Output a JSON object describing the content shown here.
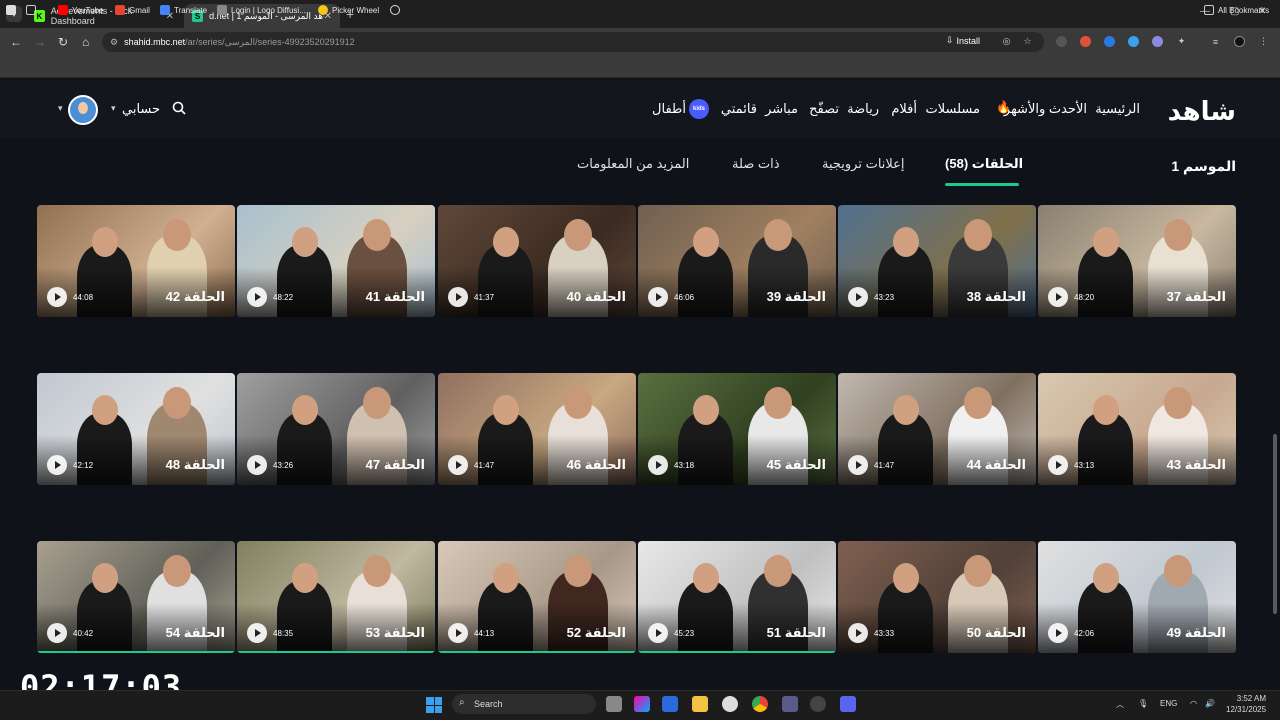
{
  "browser": {
    "tabs": [
      {
        "title": "Achievements - Kick Dashboard",
        "favicon": "K"
      },
      {
        "title": "d.net | شاهد المرسى - الموسم 1",
        "favicon": "S"
      }
    ],
    "url_host": "shahid.mbc.net",
    "url_path": "/ar/series/المرسى/series-49923520291912",
    "install_label": "Install",
    "bookmarks": [
      "YouTube",
      "Gmail",
      "Translate",
      "Login | Logo Diffusi...",
      "Picker Wheel"
    ],
    "all_bookmarks": "All Bookmarks"
  },
  "site": {
    "logo": "شاهد",
    "nav": [
      "الرئيسية",
      "الأحدث والأشهر",
      "مسلسلات",
      "أفلام",
      "رياضة",
      "تصفّح",
      "مباشر",
      "قائمتي",
      "أطفال"
    ],
    "kids_badge": "kids",
    "account_label": "حسابي"
  },
  "season": {
    "label": "الموسم 1",
    "tabs": [
      "الحلقات (58)",
      "إعلانات ترويجية",
      "ذات صلة",
      "المزيد من المعلومات"
    ]
  },
  "episodes": [
    {
      "title": "الحلقة 37",
      "duration": "48:20"
    },
    {
      "title": "الحلقة 38",
      "duration": "43:23"
    },
    {
      "title": "الحلقة 39",
      "duration": "46:06"
    },
    {
      "title": "الحلقة 40",
      "duration": "41:37"
    },
    {
      "title": "الحلقة 41",
      "duration": "48:22"
    },
    {
      "title": "الحلقة 42",
      "duration": "44:08"
    },
    {
      "title": "الحلقة 43",
      "duration": "43:13"
    },
    {
      "title": "الحلقة 44",
      "duration": "41:47"
    },
    {
      "title": "الحلقة 45",
      "duration": "43:18"
    },
    {
      "title": "الحلقة 46",
      "duration": "41:47"
    },
    {
      "title": "الحلقة 47",
      "duration": "43:26"
    },
    {
      "title": "الحلقة 48",
      "duration": "42:12"
    },
    {
      "title": "الحلقة 49",
      "duration": "42:06"
    },
    {
      "title": "الحلقة 50",
      "duration": "43:33"
    },
    {
      "title": "الحلقة 51",
      "duration": "45:23",
      "progress": 1.0
    },
    {
      "title": "الحلقة 52",
      "duration": "44:13",
      "progress": 1.0
    },
    {
      "title": "الحلقة 53",
      "duration": "48:35",
      "progress": 1.0
    },
    {
      "title": "الحلقة 54",
      "duration": "40:42",
      "progress": 1.0
    }
  ],
  "overlay_timer": "02:17:03",
  "taskbar": {
    "search_label": "Search",
    "lang": "ENG",
    "time": "3:52 AM",
    "date": "12/31/2025"
  }
}
